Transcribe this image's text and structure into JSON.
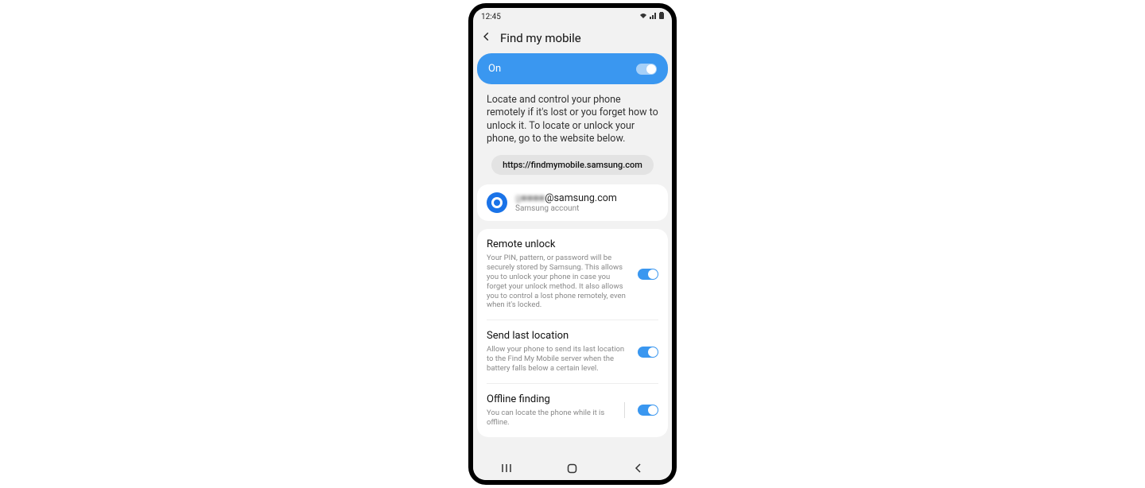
{
  "statusbar": {
    "time": "12:45"
  },
  "header": {
    "title": "Find my mobile"
  },
  "main_toggle": {
    "label": "On",
    "state": true
  },
  "description": "Locate and control your phone remotely if it's lost or you forget how to unlock it. To locate or unlock your phone, go to the website below.",
  "url_chip": "https://findmymobile.samsung.com",
  "account": {
    "email_redacted": "g■■■■",
    "email_domain": "@samsung.com",
    "subtitle": "Samsung account"
  },
  "settings": [
    {
      "title": "Remote unlock",
      "desc": "Your PIN, pattern, or password will be securely stored by Samsung. This allows you to unlock your phone in case you forget your unlock method. It also allows you to control a lost phone remotely, even when it's locked.",
      "state": true,
      "divider": false
    },
    {
      "title": "Send last location",
      "desc": "Allow your phone to send its last location to the Find My Mobile server when the battery falls below a certain level.",
      "state": true,
      "divider": false
    },
    {
      "title": "Offline finding",
      "desc": "You can locate the phone while it is offline.",
      "state": true,
      "divider": true
    }
  ]
}
